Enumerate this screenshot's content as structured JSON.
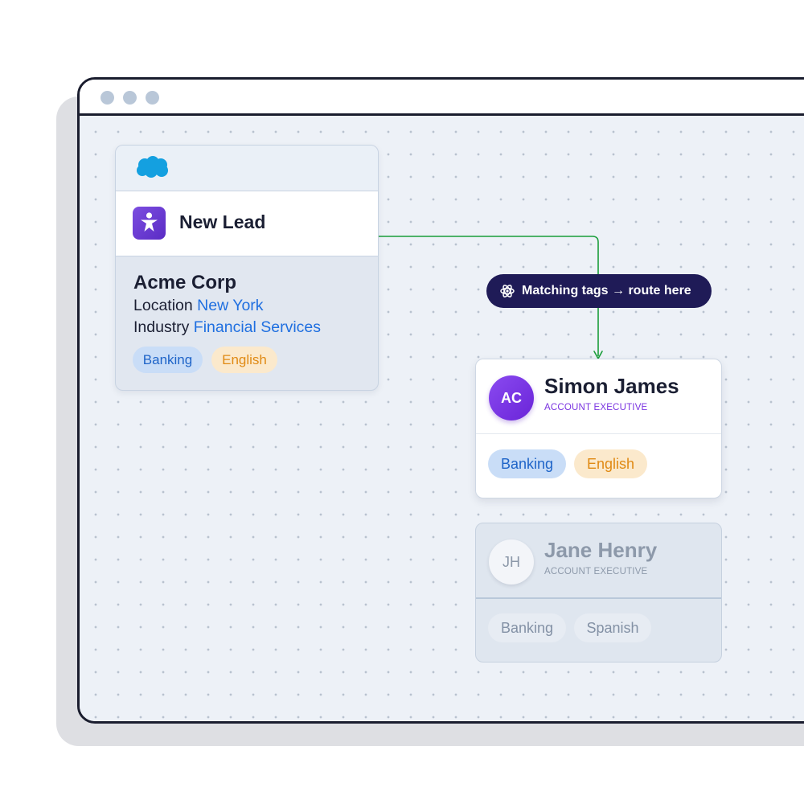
{
  "window": {
    "controls": [
      "dot",
      "dot",
      "dot"
    ]
  },
  "lead_card": {
    "source_icon": "salesforce-cloud-icon",
    "app_icon": "accessibility-person-icon",
    "title": "New Lead",
    "company": "Acme Corp",
    "location_label": "Location",
    "location_value": "New York",
    "industry_label": "Industry",
    "industry_value": "Financial Services",
    "tags": [
      "Banking",
      "English"
    ]
  },
  "routing": {
    "icon": "atom-icon",
    "label": "Matching tags → route here",
    "line_color": "#1a9e3a"
  },
  "reps": [
    {
      "initials": "AC",
      "name": "Simon James",
      "role": "ACCOUNT EXECUTIVE",
      "tags": [
        "Banking",
        "English"
      ],
      "state": "matched"
    },
    {
      "initials": "JH",
      "name": "Jane Henry",
      "role": "ACCOUNT EXECUTIVE",
      "tags": [
        "Banking",
        "Spanish"
      ],
      "state": "dimmed"
    }
  ],
  "colors": {
    "window_border": "#1a1d2e",
    "canvas": "#edf1f7",
    "pill": "#1f1b57",
    "accent_purple": "#7a33e0",
    "link_blue": "#1f6fe0",
    "tag_blue_bg": "#c9ddf7",
    "tag_orange_bg": "#fbe9cc"
  }
}
